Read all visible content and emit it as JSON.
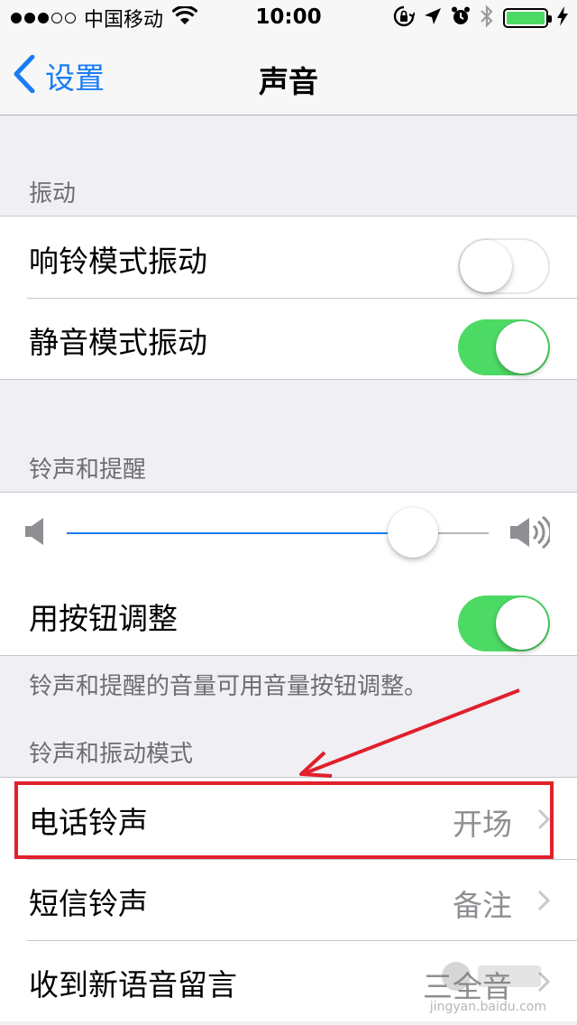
{
  "status_bar": {
    "carrier": "中国移动",
    "time": "10:00",
    "signal_dots_filled": 3,
    "signal_dots_total": 5,
    "battery_level": 1.0,
    "icons": [
      "wifi-icon",
      "orientation-lock-icon",
      "location-arrow-icon",
      "alarm-icon",
      "bluetooth-icon",
      "battery-icon",
      "charging-bolt-icon"
    ]
  },
  "nav": {
    "back_label": "设置",
    "title": "声音"
  },
  "sections": {
    "vibrate": {
      "header": "振动",
      "rows": [
        {
          "label": "响铃模式振动",
          "on": false
        },
        {
          "label": "静音模式振动",
          "on": true
        }
      ]
    },
    "ringer": {
      "header": "铃声和提醒",
      "volume_level": 0.82,
      "change_with_buttons_label": "用按钮调整",
      "change_with_buttons_on": true,
      "footer": "铃声和提醒的音量可用音量按钮调整。"
    },
    "patterns": {
      "header": "铃声和振动模式",
      "rows": [
        {
          "label": "电话铃声",
          "value": "开场"
        },
        {
          "label": "短信铃声",
          "value": "备注"
        },
        {
          "label": "收到新语音留言",
          "value": "三全音"
        }
      ]
    }
  },
  "colors": {
    "accent": "#1a7cf5",
    "switch_on": "#4cd964",
    "annotation": "#e0202b"
  },
  "watermark": {
    "text": "Baidu 经验",
    "url": "jingyan.baidu.com"
  }
}
